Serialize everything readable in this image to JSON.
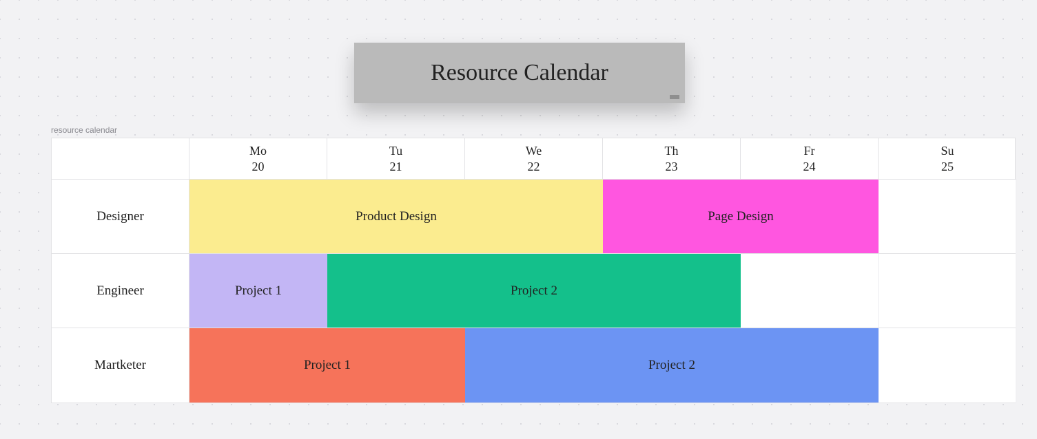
{
  "title": "Resource Calendar",
  "caption": "resource calendar",
  "columns": [
    {
      "dow": "Mo",
      "num": "20"
    },
    {
      "dow": "Tu",
      "num": "21"
    },
    {
      "dow": "We",
      "num": "22"
    },
    {
      "dow": "Th",
      "num": "23"
    },
    {
      "dow": "Fr",
      "num": "24"
    },
    {
      "dow": "Su",
      "num": "25"
    }
  ],
  "rows": [
    {
      "label": "Designer"
    },
    {
      "label": "Engineer"
    },
    {
      "label": "Martketer"
    }
  ],
  "bars": {
    "r0": [
      {
        "label": "Product Design",
        "start": 0,
        "span": 3,
        "color": "#fbec8f"
      },
      {
        "label": "Page Design",
        "start": 3,
        "span": 2,
        "color": "#ff56e0"
      }
    ],
    "r1": [
      {
        "label": "Project 1",
        "start": 0,
        "span": 1,
        "color": "#c3b6f5"
      },
      {
        "label": "Project 2",
        "start": 1,
        "span": 3,
        "color": "#14c08b"
      }
    ],
    "r2": [
      {
        "label": "Project 1",
        "start": 0,
        "span": 2,
        "color": "#f6735a"
      },
      {
        "label": "Project 2",
        "start": 2,
        "span": 3,
        "color": "#6c94f3"
      }
    ]
  },
  "chart_data": {
    "type": "table",
    "title": "Resource Calendar",
    "columns": [
      "Mo 20",
      "Tu 21",
      "We 22",
      "Th 23",
      "Fr 24",
      "Su 25"
    ],
    "resources": [
      {
        "name": "Designer",
        "tasks": [
          {
            "name": "Product Design",
            "days": [
              "Mo 20",
              "Tu 21",
              "We 22"
            ]
          },
          {
            "name": "Page Design",
            "days": [
              "Th 23",
              "Fr 24"
            ]
          }
        ]
      },
      {
        "name": "Engineer",
        "tasks": [
          {
            "name": "Project 1",
            "days": [
              "Mo 20"
            ]
          },
          {
            "name": "Project 2",
            "days": [
              "Tu 21",
              "We 22",
              "Th 23"
            ]
          }
        ]
      },
      {
        "name": "Martketer",
        "tasks": [
          {
            "name": "Project 1",
            "days": [
              "Mo 20",
              "Tu 21"
            ]
          },
          {
            "name": "Project 2",
            "days": [
              "We 22",
              "Th 23",
              "Fr 24"
            ]
          }
        ]
      }
    ]
  }
}
